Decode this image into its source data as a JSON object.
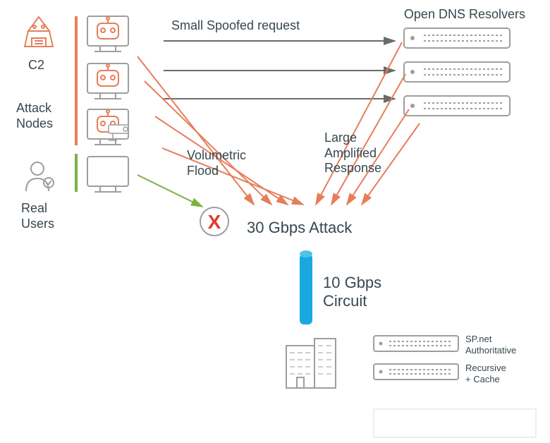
{
  "labels": {
    "c2": "C2",
    "attack_nodes_line1": "Attack",
    "attack_nodes_line2": "Nodes",
    "real_users_line1": "Real",
    "real_users_line2": "Users",
    "spoofed_request": "Small Spoofed request",
    "open_dns": "Open DNS Resolvers",
    "volumetric_line1": "Volumetric",
    "volumetric_line2": "Flood",
    "amplified_line1": "Large",
    "amplified_line2": "Amplified",
    "amplified_line3": "Response",
    "attack": "30 Gbps Attack",
    "circuit_line1": "10 Gbps",
    "circuit_line2": "Circuit",
    "sp_net": "SP.net",
    "authoritative": "Authoritative",
    "recursive": "Recursive",
    "cache": "+ Cache",
    "denied": "X"
  },
  "colors": {
    "orange": "#e67e5a",
    "green": "#7cb342",
    "gray": "#9e9e9e",
    "cyan": "#19a9e0",
    "red": "#e03a2c",
    "text": "#37474f"
  }
}
